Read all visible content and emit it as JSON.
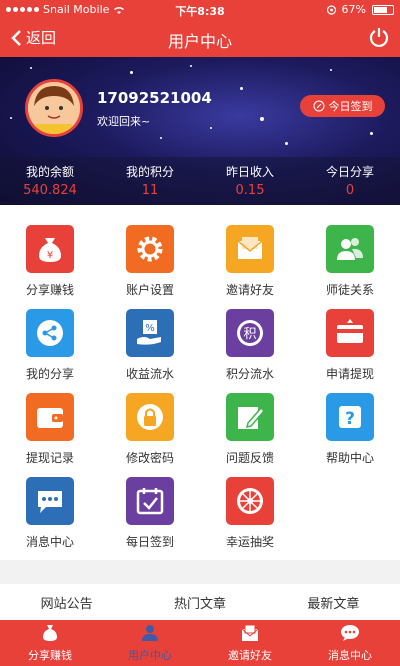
{
  "status_bar": {
    "carrier": "Snail Mobile",
    "time": "下午8:38",
    "battery": "67%"
  },
  "nav": {
    "back_label": "返回",
    "title": "用户中心"
  },
  "profile": {
    "phone": "17092521004",
    "welcome": "欢迎回来~",
    "signin_label": "今日签到"
  },
  "stats": [
    {
      "label": "我的余额",
      "value": "540.824"
    },
    {
      "label": "我的积分",
      "value": "11"
    },
    {
      "label": "昨日收入",
      "value": "0.15"
    },
    {
      "label": "今日分享",
      "value": "0"
    }
  ],
  "menu": [
    {
      "label": "分享赚钱",
      "icon": "money-bag-icon",
      "color": "#e8413a"
    },
    {
      "label": "账户设置",
      "icon": "gear-icon",
      "color": "#f26b22"
    },
    {
      "label": "邀请好友",
      "icon": "invite-letter-icon",
      "color": "#f5a623"
    },
    {
      "label": "师徒关系",
      "icon": "users-icon",
      "color": "#3db54a"
    },
    {
      "label": "我的分享",
      "icon": "share-icon",
      "color": "#2b9ae6"
    },
    {
      "label": "收益流水",
      "icon": "percent-hand-icon",
      "color": "#2c6fb6"
    },
    {
      "label": "积分流水",
      "icon": "points-icon",
      "color": "#6b3fa0"
    },
    {
      "label": "申请提现",
      "icon": "card-icon",
      "color": "#e8413a"
    },
    {
      "label": "提现记录",
      "icon": "wallet-icon",
      "color": "#f26b22"
    },
    {
      "label": "修改密码",
      "icon": "lock-icon",
      "color": "#f5a623"
    },
    {
      "label": "问题反馈",
      "icon": "pencil-icon",
      "color": "#3db54a"
    },
    {
      "label": "帮助中心",
      "icon": "question-icon",
      "color": "#2b9ae6"
    },
    {
      "label": "消息中心",
      "icon": "chat-icon",
      "color": "#2c6fb6"
    },
    {
      "label": "每日签到",
      "icon": "calendar-check-icon",
      "color": "#6b3fa0"
    },
    {
      "label": "幸运抽奖",
      "icon": "lottery-wheel-icon",
      "color": "#e8413a"
    }
  ],
  "tabs": [
    {
      "label": "网站公告"
    },
    {
      "label": "热门文章"
    },
    {
      "label": "最新文章"
    }
  ],
  "bottom_nav": [
    {
      "label": "分享赚钱",
      "icon": "money-bag-icon"
    },
    {
      "label": "用户中心",
      "icon": "user-icon",
      "active": true
    },
    {
      "label": "邀请好友",
      "icon": "invite-letter-icon"
    },
    {
      "label": "消息中心",
      "icon": "chat-icon"
    }
  ],
  "colors": {
    "brand": "#e8413a",
    "accent_value": "#e8413a",
    "active_nav": "#3f5aa6"
  }
}
